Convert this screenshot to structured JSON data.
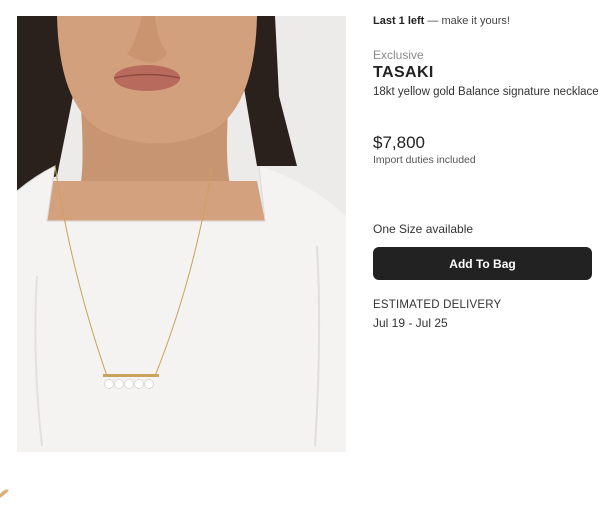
{
  "product": {
    "stock_emphasis": "Last 1 left",
    "stock_rest": "— make it yours!",
    "tag": "Exclusive",
    "brand": "TASAKI",
    "description": "18kt yellow gold Balance signature necklace",
    "price": "$7,800",
    "duties_note": "Import duties included",
    "size_note": "One Size available",
    "add_to_bag_label": "Add To Bag"
  },
  "delivery": {
    "label": "ESTIMATED DELIVERY",
    "dates": "Jul 19 - Jul 25"
  },
  "image": {
    "subject": "model wearing pearl bar necklace",
    "icons": [
      "necklace-photo"
    ]
  },
  "colors": {
    "button_bg": "#222222",
    "button_text": "#ffffff",
    "muted_text": "#8a8a8a"
  }
}
